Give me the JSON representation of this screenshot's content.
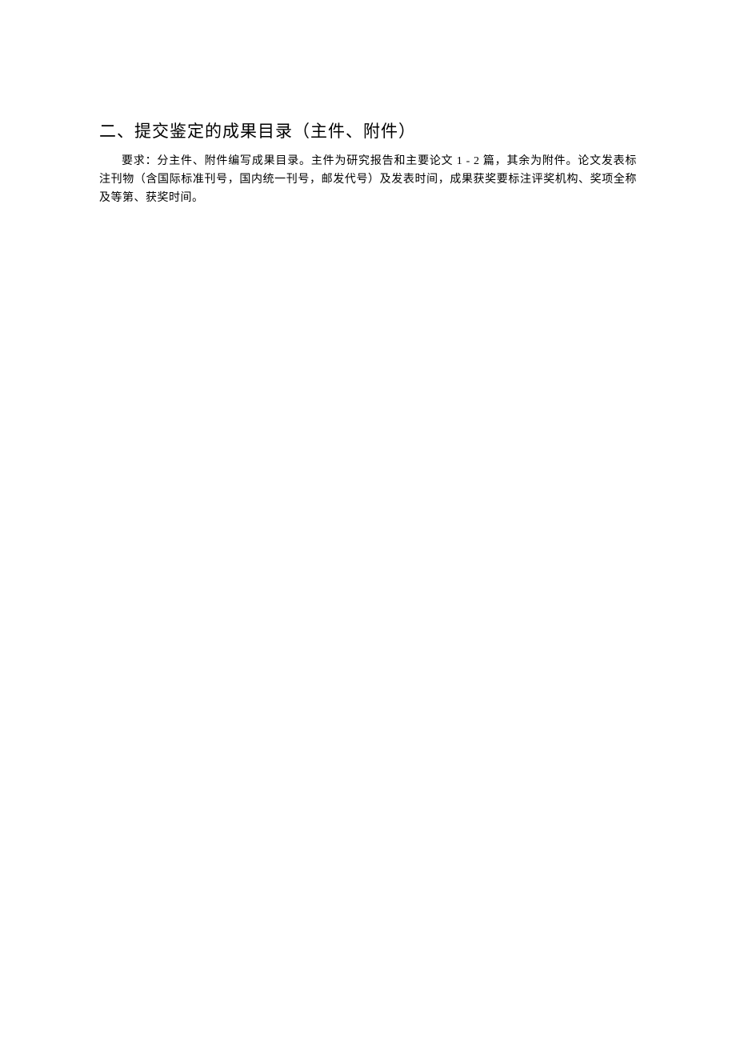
{
  "document": {
    "heading": "二、提交鉴定的成果目录（主件、附件）",
    "body": "要求：分主件、附件编写成果目录。主件为研究报告和主要论文 1 - 2 篇，其余为附件。论文发表标注刊物（含国际标准刊号，国内统一刊号，邮发代号）及发表时间，成果获奖要标注评奖机构、奖项全称及等第、获奖时间。"
  }
}
